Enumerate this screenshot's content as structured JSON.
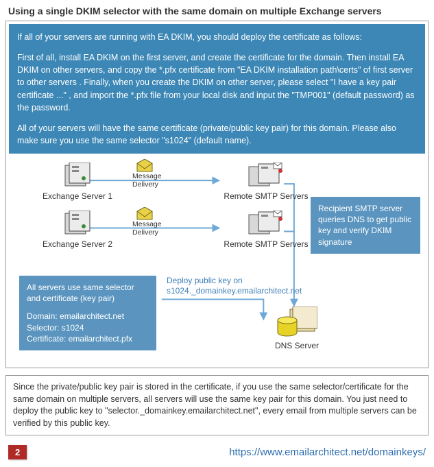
{
  "title": "Using a single DKIM selector with the same domain on multiple Exchange servers",
  "info": {
    "p1": "If all of your servers are running with EA DKIM, you should deploy the certificate as follows:",
    "p2": "First of all, install EA DKIM on the first server, and create the certificate for the domain. Then install EA DKIM on other servers, and copy the *.pfx certificate from \"EA DKIM installation path\\certs\" of first server to other servers . Finally, when you create the DKIM on other server, please select \"I have a key pair certificate ...\" , and import the *.pfx file from your local disk and input the \"TMP001\" (default password) as the password.",
    "p3": "All of your servers will have the same certificate (private/public key pair) for this domain. Please also make sure you use the same selector \"s1024\" (default name)."
  },
  "diagram": {
    "exchange1": "Exchange Server 1",
    "exchange2": "Exchange Server 2",
    "smtp1": "Remote SMTP Servers",
    "smtp2": "Remote SMTP Servers",
    "dns": "DNS Server",
    "msg_delivery": "Message\nDelivery",
    "deploy_label": "Deploy public key on\ns1024._domainkey.emailarchitect.net",
    "callout_right": "Recipient SMTP server queries DNS to get public key and verify DKIM signature",
    "callout_left_head": "All servers use same selector and certificate (key pair)",
    "callout_left_body": "Domain: emailarchitect.net\nSelector: s1024\nCertificate: emailarchitect.pfx"
  },
  "bottom_note": "Since the private/public key pair is stored in the certificate, if you use the same selector/certificate for the same domain on multiple servers, all servers will use the same key pair for this domain. You just need to deploy the public key to \"selector._domainkey.emailarchitect.net\", every email from multiple servers can be verified by this public key.",
  "footer": {
    "page": "2",
    "url": "https://www.emailarchitect.net/domainkeys/"
  }
}
